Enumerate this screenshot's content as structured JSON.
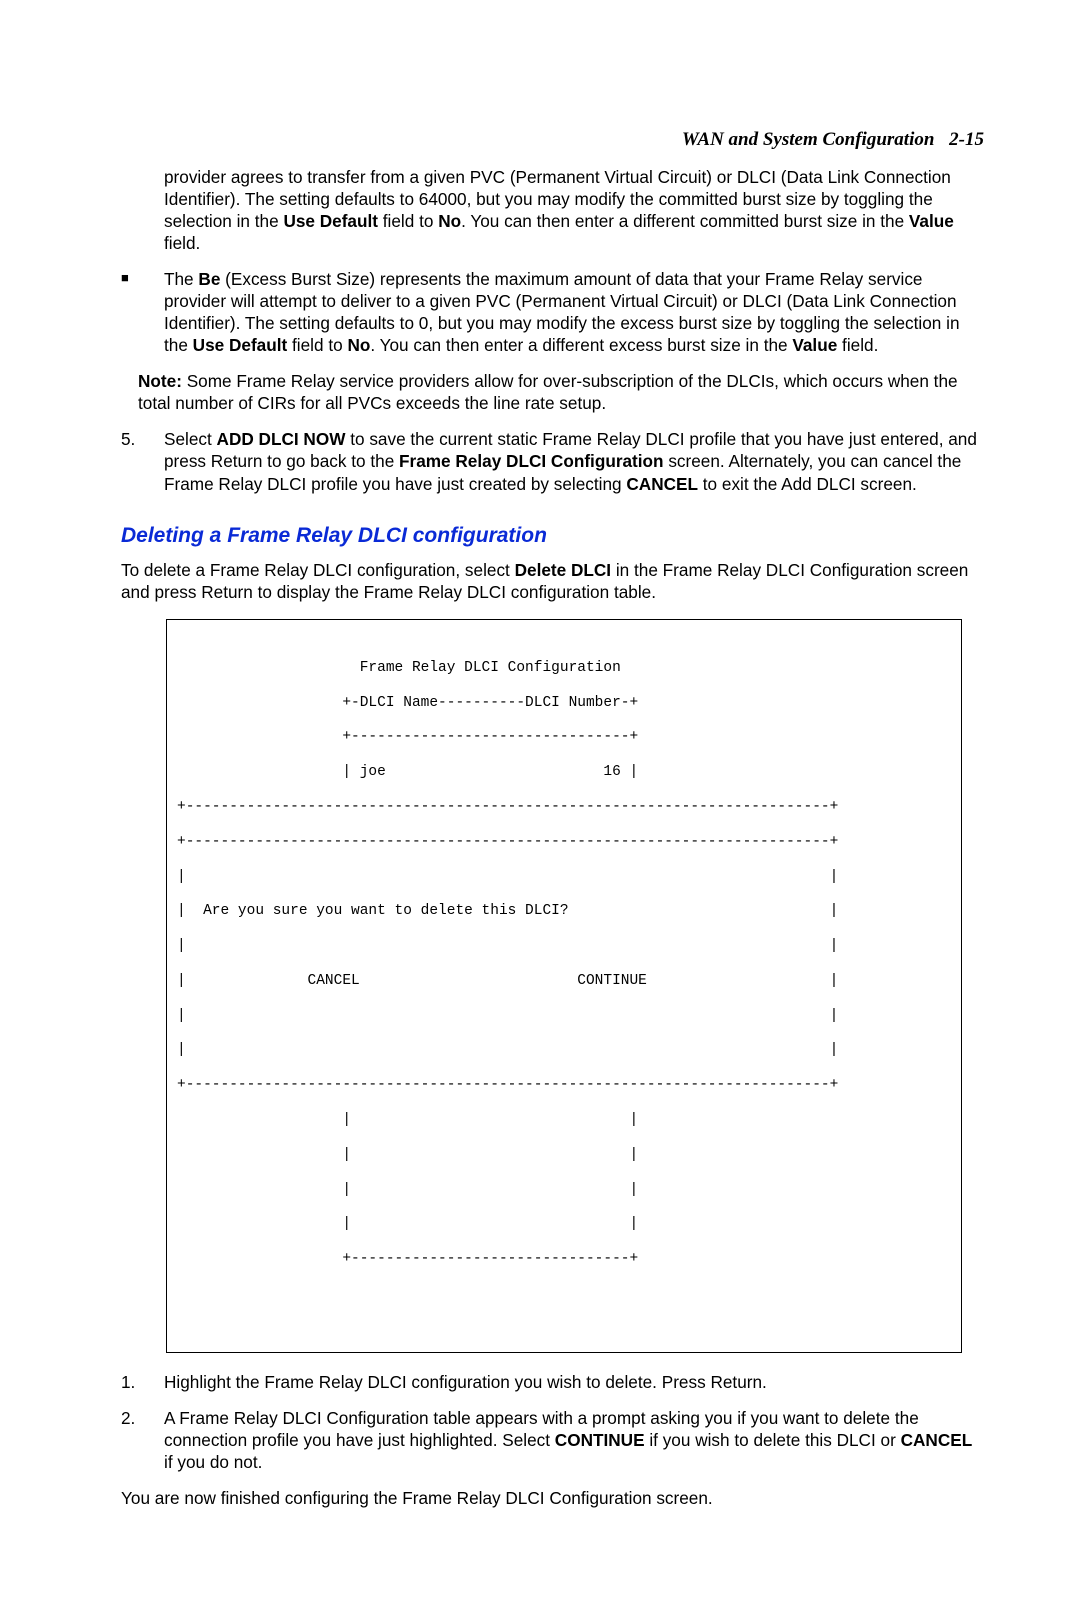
{
  "header": {
    "section_title": "WAN and System Configuration",
    "page_number": "2-15"
  },
  "cont_para": {
    "pre1": "provider agrees to transfer from a given PVC (Permanent Virtual Circuit) or DLCI (Data Link Connection Identifier). The setting defaults to 64000, but you may modify the committed burst size by toggling the selection in the ",
    "b1": "Use Default",
    "mid1": " field to ",
    "b2": "No",
    "mid2": ". You can then enter a different committed burst size in the ",
    "b3": "Value",
    "post": " field."
  },
  "bullet_be": {
    "bullet_char": "■",
    "pre": "The ",
    "b1": "Be",
    "t1": " (Excess Burst Size) represents the maximum amount of data that your Frame Relay service provider will attempt to deliver to a given PVC (Permanent Virtual Circuit) or DLCI (Data Link Connection Identifier). The setting defaults to 0, but you may modify the excess burst size by toggling the selection in the ",
    "b2": "Use Default",
    "t2": " field to ",
    "b3": "No",
    "t3": ". You can then enter a different excess burst size in the ",
    "b4": "Value",
    "t4": " field."
  },
  "note": {
    "label": "Note:",
    "text": "  Some Frame Relay service providers allow for over-subscription of the DLCIs, which occurs when the total number of CIRs for all PVCs exceeds the line rate setup."
  },
  "step5": {
    "num": "5.",
    "pre": "Select ",
    "b1": "ADD DLCI NOW",
    "t1": " to save the current static Frame Relay DLCI profile that you have just entered, and press Return to go back to the ",
    "b2": "Frame Relay DLCI Configuration",
    "t2": " screen. Alternately, you can cancel the Frame Relay DLCI profile you have just created by selecting ",
    "b3": "CANCEL",
    "t3": " to exit the Add DLCI screen."
  },
  "section_heading": "Deleting a Frame Relay DLCI configuration",
  "intro": {
    "pre": "To delete a Frame Relay DLCI configuration, select ",
    "b1": "Delete DLCI",
    "post": " in the Frame Relay DLCI Configuration screen and press Return to display the Frame Relay DLCI configuration table."
  },
  "terminal": {
    "l1": "                     Frame Relay DLCI Configuration",
    "l2": "                   +-DLCI Name----------DLCI Number-+",
    "l3": "                   +--------------------------------+",
    "l4": "                   | joe                         16 |",
    "l5": "+--------------------------------------------------------------------------+",
    "l6": "+--------------------------------------------------------------------------+",
    "l7": "|                                                                          |",
    "l8": "|  Are you sure you want to delete this DLCI?                              |",
    "l9": "|                                                                          |",
    "l10": "|              CANCEL                         CONTINUE                     |",
    "l11": "|                                                                          |",
    "l12": "|                                                                          |",
    "l13": "+--------------------------------------------------------------------------+",
    "l14": "                   |                                |",
    "l15": "                   |                                |",
    "l16": "                   |                                |",
    "l17": "                   |                                |",
    "l18": "                   +--------------------------------+",
    "l19": "",
    "l20": "",
    "l21": ""
  },
  "step1": {
    "num": "1.",
    "text": "Highlight the Frame Relay DLCI configuration you wish to delete. Press Return."
  },
  "step2": {
    "num": "2.",
    "pre": "A Frame Relay DLCI Configuration table appears with a prompt asking you if you want to delete the connection profile you have just highlighted. Select ",
    "b1": "CONTINUE",
    "mid": " if you wish to delete this DLCI or ",
    "b2": "CANCEL",
    "post": " if you do not."
  },
  "closing": "You are now finished configuring the Frame Relay DLCI Configuration screen."
}
